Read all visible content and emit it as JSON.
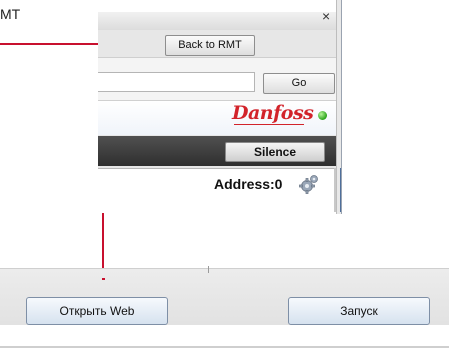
{
  "callout": {
    "text": "МТ",
    "line_color": "#c8102e"
  },
  "browser": {
    "close_symbol": "×",
    "back_button": "Back to RMT",
    "address_value": "",
    "go_button": "Go",
    "brand_logo": "Danfoss",
    "brand_color": "#d2232a",
    "status_color": "#2aa319",
    "silence_button": "Silence",
    "address_label": "Address:0",
    "gear_icon": "gear-icon"
  },
  "dialog": {
    "open_web_button": "Открыть Web",
    "launch_button": "Запуск"
  }
}
